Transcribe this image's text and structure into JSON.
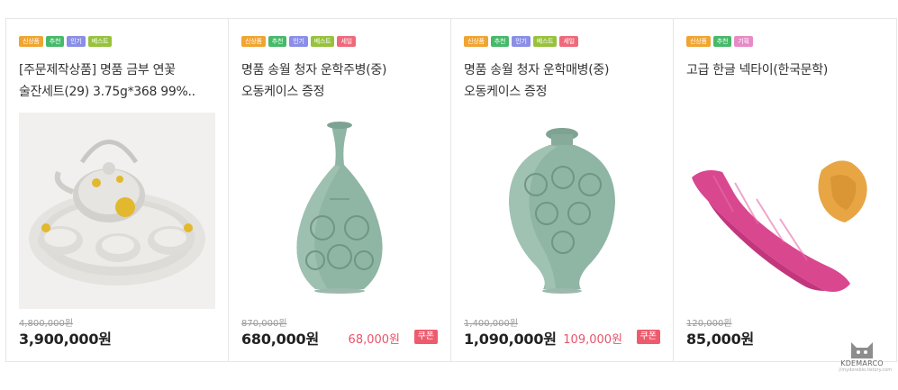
{
  "products": [
    {
      "badges": [
        {
          "label": "신상품",
          "kind": "new"
        },
        {
          "label": "추천",
          "kind": "rec"
        },
        {
          "label": "인기",
          "kind": "pop"
        },
        {
          "label": "베스트",
          "kind": "best"
        }
      ],
      "title": "[주문제작상품] 명품 금부 연꽃 술잔세트(29) 3.75g*368 99%..",
      "image": "silver-tea-set-image",
      "original_price": "4,800,000원",
      "price": "3,900,000원",
      "coupon_price": "",
      "coupon_label": ""
    },
    {
      "badges": [
        {
          "label": "신상품",
          "kind": "new"
        },
        {
          "label": "추천",
          "kind": "rec"
        },
        {
          "label": "인기",
          "kind": "pop"
        },
        {
          "label": "베스트",
          "kind": "best"
        },
        {
          "label": "세일",
          "kind": "sale"
        }
      ],
      "title": "명품 송월 청자 운학주병(중)오동케이스 증정",
      "image": "celadon-bottle-vase-image",
      "original_price": "870,000원",
      "price": "680,000원",
      "coupon_price": "68,000원",
      "coupon_label": "쿠폰"
    },
    {
      "badges": [
        {
          "label": "신상품",
          "kind": "new"
        },
        {
          "label": "추천",
          "kind": "rec"
        },
        {
          "label": "인기",
          "kind": "pop"
        },
        {
          "label": "베스트",
          "kind": "best"
        },
        {
          "label": "세일",
          "kind": "sale"
        }
      ],
      "title": "명품 송월 청자 운학매병(중)오동케이스 증정",
      "image": "celadon-maebyeong-vase-image",
      "original_price": "1,400,000원",
      "price": "1,090,000원",
      "coupon_price": "109,000원",
      "coupon_label": "쿠폰"
    },
    {
      "badges": [
        {
          "label": "신상품",
          "kind": "new"
        },
        {
          "label": "추천",
          "kind": "rec"
        },
        {
          "label": "기획",
          "kind": "plan"
        }
      ],
      "title": "고급 한글 넥타이(한국문학)",
      "image": "pink-necktie-image",
      "original_price": "120,000원",
      "price": "85,000원",
      "coupon_price": "",
      "coupon_label": ""
    }
  ],
  "watermark": {
    "brand": "KDEMARCO",
    "url": "//mydoreblo.tistory.com",
    "icon": "cat-icon"
  },
  "colors": {
    "price_text": "#222222",
    "coupon_text": "#e8546a",
    "coupon_badge": "#ef5b6e",
    "border": "#e6e6e6"
  }
}
